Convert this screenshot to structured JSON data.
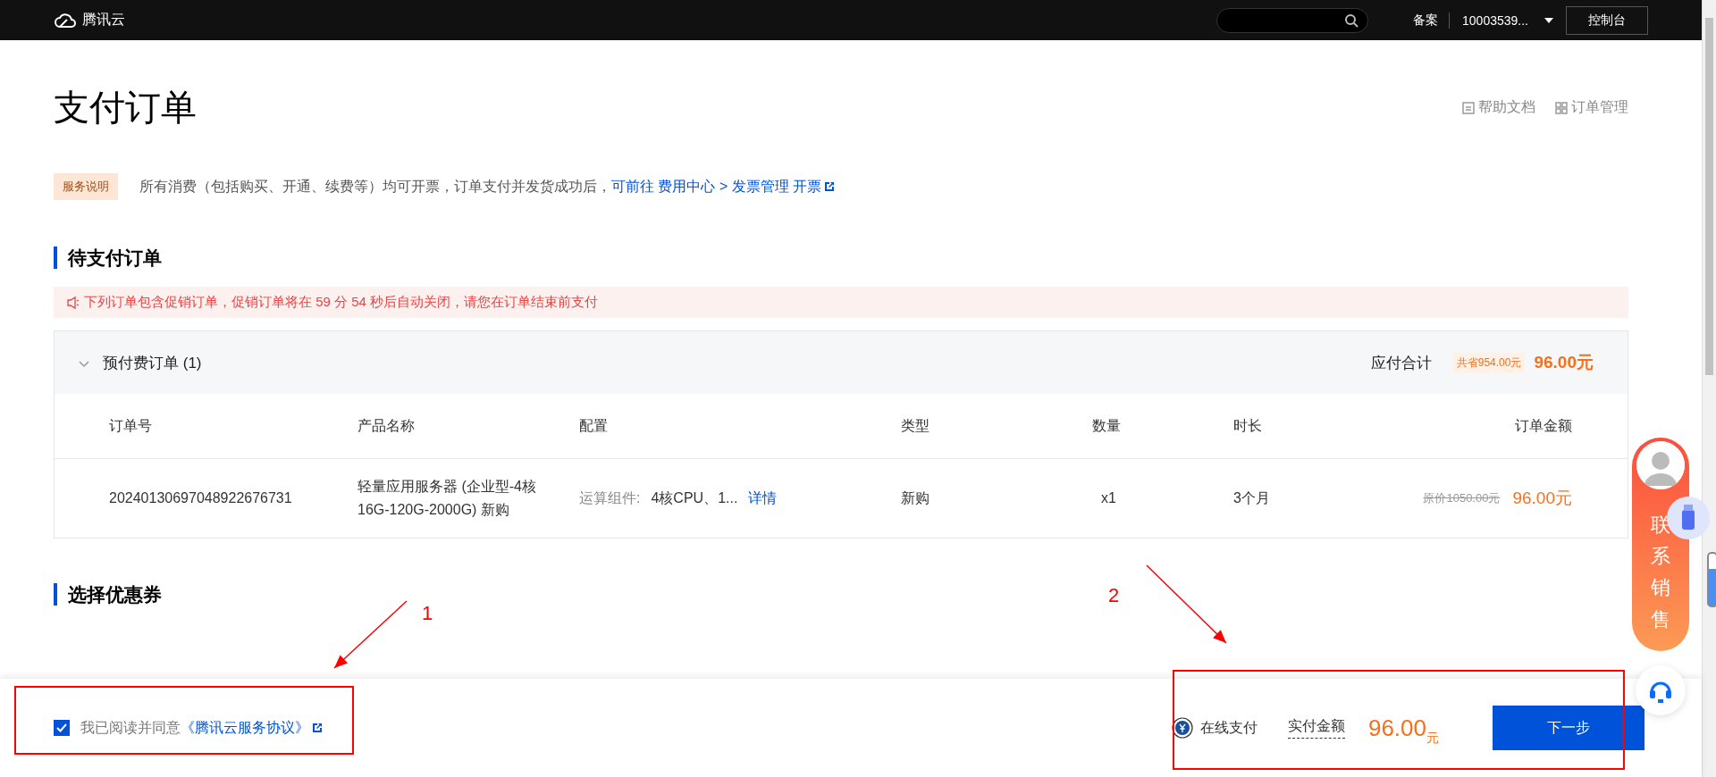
{
  "top_bar": {
    "logo_text": "腾讯云",
    "links": [
      "备案"
    ],
    "account": "10003539...",
    "console_button": "控制台"
  },
  "page": {
    "title": "支付订单",
    "header_links": [
      {
        "kind": "doc",
        "label": "帮助文档"
      },
      {
        "kind": "grid",
        "label": "订单管理"
      }
    ]
  },
  "service_note": {
    "tag": "服务说明",
    "text": "所有消费（包括购买、开通、续费等）均可开票，订单支付并发货成功后，",
    "link": "可前往 费用中心 > 发票管理 开票"
  },
  "pending_section": {
    "heading": "待支付订单",
    "alert": "下列订单包含促销订单，促销订单将在 59 分 54 秒后自动关闭，请您在订单结束前支付",
    "order_group": {
      "title": "预付费订单 (1)",
      "expanded": true,
      "total_label": "应付合计",
      "savings": "共省954.00元",
      "total": "96.00元",
      "columns": [
        "订单号",
        "产品名称",
        "配置",
        "类型",
        "数量",
        "时长",
        "订单金额"
      ],
      "rows": [
        {
          "order_no": "20240130697048922676731",
          "product": "轻量应用服务器 (企业型-4核16G-120G-2000G) 新购",
          "config_label": "运算组件:",
          "config_value": "4核CPU、1...",
          "details_link": "详情",
          "type": "新购",
          "quantity": "x1",
          "duration": "3个月",
          "original_price": "原价1050.00元",
          "amount": "96.00元"
        }
      ]
    }
  },
  "coupon_section": {
    "heading": "选择优惠券"
  },
  "footer": {
    "agreement": {
      "checked": true,
      "text": "我已阅读并同意",
      "link": "《腾讯云服务协议》"
    },
    "payment_method": "在线支付",
    "amount_label": "实付金额",
    "amount": "96.00",
    "currency": "元",
    "next_button": "下一步"
  },
  "side_widget": {
    "contact_label": "联系销售"
  },
  "annotations": [
    {
      "label": "1"
    },
    {
      "label": "2"
    }
  ]
}
